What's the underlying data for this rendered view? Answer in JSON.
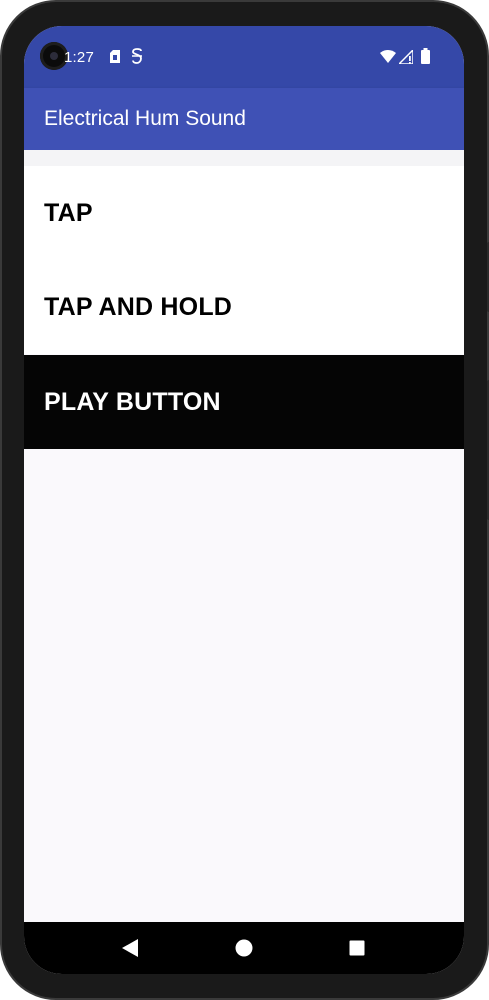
{
  "status_bar": {
    "time": "1:27",
    "left_icons": [
      "sim-card-icon",
      "notification-s-icon"
    ],
    "right_icons": [
      "wifi-icon",
      "signal-icon",
      "battery-icon"
    ]
  },
  "app_bar": {
    "title": "Electrical Hum Sound"
  },
  "list": {
    "items": [
      {
        "label": "TAP",
        "selected": false
      },
      {
        "label": "TAP AND HOLD",
        "selected": false
      },
      {
        "label": "PLAY BUTTON",
        "selected": true
      }
    ]
  },
  "nav_bar": {
    "buttons": [
      "back-icon",
      "home-icon",
      "recents-icon"
    ]
  },
  "colors": {
    "status_bar": "#3548a8",
    "app_bar": "#3f51b5",
    "selected_item_bg": "#050505",
    "item_bg": "#ffffff",
    "content_bg": "#faf9fc"
  }
}
